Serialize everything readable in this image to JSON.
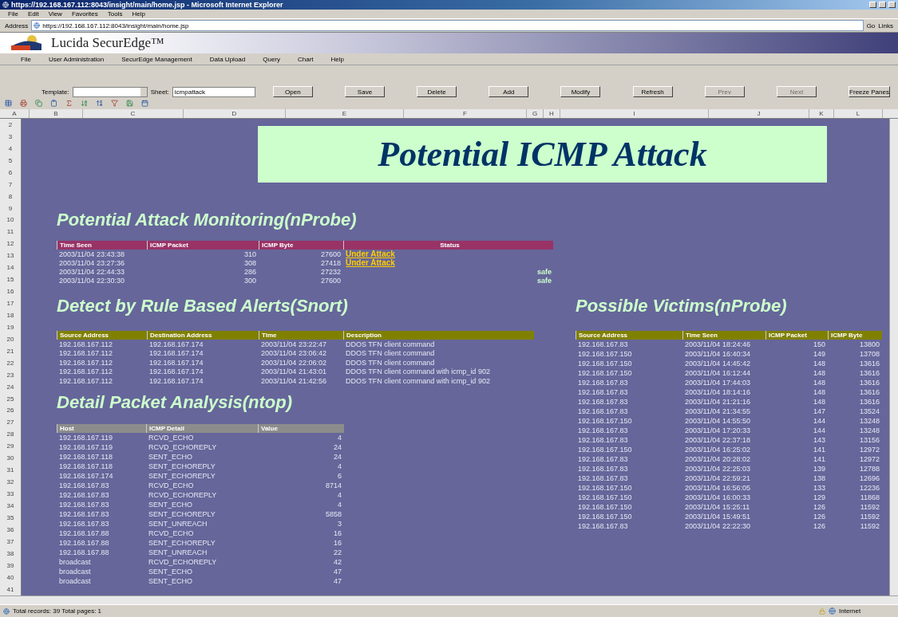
{
  "window": {
    "title": "https://192.168.167.112:8043/insight/main/home.jsp - Microsoft Internet Explorer"
  },
  "browser_menu": [
    "File",
    "Edit",
    "View",
    "Favorites",
    "Tools",
    "Help"
  ],
  "address_bar": {
    "label": "Address",
    "value": "https://192.168.167.112:8043/insight/main/home.jsp",
    "go": "Go",
    "links": "Links"
  },
  "app": {
    "name": "Lucida SecurEdge™"
  },
  "app_menu": [
    "File",
    "User Administration",
    "SecurEdge Management",
    "Data Upload",
    "Query",
    "Chart",
    "Help"
  ],
  "toolbar": {
    "template_label": "Template:",
    "sheet_label": "Sheet:",
    "sheet_value": "icmpattack",
    "buttons": [
      {
        "label": "Open",
        "disabled": false
      },
      {
        "label": "Save",
        "disabled": false
      },
      {
        "label": "Delete",
        "disabled": false
      },
      {
        "label": "Add",
        "disabled": false
      },
      {
        "label": "Modify",
        "disabled": false
      },
      {
        "label": "Refresh",
        "disabled": false
      },
      {
        "label": "Prev",
        "disabled": true
      },
      {
        "label": "Next",
        "disabled": true
      },
      {
        "label": "Freeze Panes",
        "disabled": false
      }
    ]
  },
  "column_letters": [
    "A",
    "B",
    "C",
    "D",
    "E",
    "F",
    "G",
    "H",
    "I",
    "J",
    "K",
    "L"
  ],
  "row_numbers": [
    "2",
    "3",
    "4",
    "5",
    "6",
    "7",
    "8",
    "9",
    "10",
    "11",
    "12",
    "13",
    "14",
    "15",
    "16",
    "17",
    "18",
    "19",
    "20",
    "21",
    "22",
    "23",
    "24",
    "25",
    "26",
    "27",
    "28",
    "29",
    "30",
    "31",
    "32",
    "33",
    "34",
    "35",
    "36",
    "37",
    "38",
    "39",
    "40",
    "41"
  ],
  "title": "Potential ICMP Attack",
  "attack": {
    "heading": "Potential Attack Monitoring(nProbe)",
    "columns": [
      "Time Seen",
      "ICMP Packet",
      "ICMP Byte",
      "Status"
    ],
    "rows": [
      {
        "time": "2003/11/04 23:43:38",
        "packets": "310",
        "bytes": "27600",
        "status": {
          "text": "Under Attack",
          "kind": "attack"
        }
      },
      {
        "time": "2003/11/04 23:27:36",
        "packets": "308",
        "bytes": "27418",
        "status": {
          "text": "Under Attack",
          "kind": "attack"
        }
      },
      {
        "time": "2003/11/04 22:44:33",
        "packets": "286",
        "bytes": "27232",
        "status": {
          "text": "safe",
          "kind": "safe"
        }
      },
      {
        "time": "2003/11/04 22:30:30",
        "packets": "300",
        "bytes": "27600",
        "status": {
          "text": "safe",
          "kind": "safe"
        }
      }
    ]
  },
  "snort": {
    "heading": "Detect by Rule Based Alerts(Snort)",
    "columns": [
      "Source Address",
      "Destination Address",
      "Time",
      "Description"
    ],
    "rows": [
      [
        "192.168.167.112",
        "192.168.167.174",
        "2003/11/04 23:22:47",
        "DDOS TFN client command"
      ],
      [
        "192.168.167.112",
        "192.168.167.174",
        "2003/11/04 23:06:42",
        "DDOS TFN client command"
      ],
      [
        "192.168.167.112",
        "192.168.167.174",
        "2003/11/04 22:06:02",
        "DDOS TFN client command"
      ],
      [
        "192.168.167.112",
        "192.168.167.174",
        "2003/11/04 21:43:01",
        "DDOS TFN client command with icmp_id 902"
      ],
      [
        "192.168.167.112",
        "192.168.167.174",
        "2003/11/04 21:42:56",
        "DDOS TFN client command with icmp_id 902"
      ]
    ]
  },
  "ntop": {
    "heading": "Detail Packet Analysis(ntop)",
    "columns": [
      "Host",
      "ICMP Detail",
      "Value"
    ],
    "rows": [
      [
        "192.168.167.119",
        "RCVD_ECHO",
        "4"
      ],
      [
        "192.168.167.119",
        "RCVD_ECHOREPLY",
        "24"
      ],
      [
        "192.168.167.118",
        "SENT_ECHO",
        "24"
      ],
      [
        "192.168.167.118",
        "SENT_ECHOREPLY",
        "4"
      ],
      [
        "192.168.167.174",
        "SENT_ECHOREPLY",
        "6"
      ],
      [
        "192.168.167.83",
        "RCVD_ECHO",
        "8714"
      ],
      [
        "192.168.167.83",
        "RCVD_ECHOREPLY",
        "4"
      ],
      [
        "192.168.167.83",
        "SENT_ECHO",
        "4"
      ],
      [
        "192.168.167.83",
        "SENT_ECHOREPLY",
        "5858"
      ],
      [
        "192.168.167.83",
        "SENT_UNREACH",
        "3"
      ],
      [
        "192.168.167.88",
        "RCVD_ECHO",
        "16"
      ],
      [
        "192.168.167.88",
        "SENT_ECHOREPLY",
        "16"
      ],
      [
        "192.168.167.88",
        "SENT_UNREACH",
        "22"
      ],
      [
        "broadcast",
        "RCVD_ECHOREPLY",
        "42"
      ],
      [
        "broadcast",
        "SENT_ECHO",
        "47"
      ],
      [
        "broadcast",
        "SENT_ECHO",
        "47"
      ]
    ]
  },
  "victims": {
    "heading": "Possible Victims(nProbe)",
    "columns": [
      "Source Address",
      "Time Seen",
      "ICMP Packet",
      "ICMP Byte"
    ],
    "rows": [
      [
        "192.168.167.83",
        "2003/11/04 18:24:46",
        "150",
        "13800"
      ],
      [
        "192.168.167.150",
        "2003/11/04 16:40:34",
        "149",
        "13708"
      ],
      [
        "192.168.167.150",
        "2003/11/04 14:45:42",
        "148",
        "13616"
      ],
      [
        "192.168.167.150",
        "2003/11/04 16:12:44",
        "148",
        "13616"
      ],
      [
        "192.168.167.83",
        "2003/11/04 17:44:03",
        "148",
        "13616"
      ],
      [
        "192.168.167.83",
        "2003/11/04 18:14:16",
        "148",
        "13616"
      ],
      [
        "192.168.167.83",
        "2003/11/04 21:21:16",
        "148",
        "13616"
      ],
      [
        "192.168.167.83",
        "2003/11/04 21:34:55",
        "147",
        "13524"
      ],
      [
        "192.168.167.150",
        "2003/11/04 14:55:50",
        "144",
        "13248"
      ],
      [
        "192.168.167.83",
        "2003/11/04 17:20:33",
        "144",
        "13248"
      ],
      [
        "192.168.167.83",
        "2003/11/04 22:37:18",
        "143",
        "13156"
      ],
      [
        "192.168.167.150",
        "2003/11/04 16:25:02",
        "141",
        "12972"
      ],
      [
        "192.168.167.83",
        "2003/11/04 20:28:02",
        "141",
        "12972"
      ],
      [
        "192.168.167.83",
        "2003/11/04 22:25:03",
        "139",
        "12788"
      ],
      [
        "192.168.167.83",
        "2003/11/04 22:59:21",
        "138",
        "12696"
      ],
      [
        "192.168.167.150",
        "2003/11/04 16:56:05",
        "133",
        "12236"
      ],
      [
        "192.168.167.150",
        "2003/11/04 16:00:33",
        "129",
        "11868"
      ],
      [
        "192.168.167.150",
        "2003/11/04 15:25:11",
        "126",
        "11592"
      ],
      [
        "192.168.167.150",
        "2003/11/04 15:49:51",
        "126",
        "11592"
      ],
      [
        "192.168.167.83",
        "2003/11/04 22:22:30",
        "126",
        "11592"
      ]
    ]
  },
  "status_bar": {
    "text": "Total records: 39  Total pages: 1",
    "zone": "Internet"
  }
}
